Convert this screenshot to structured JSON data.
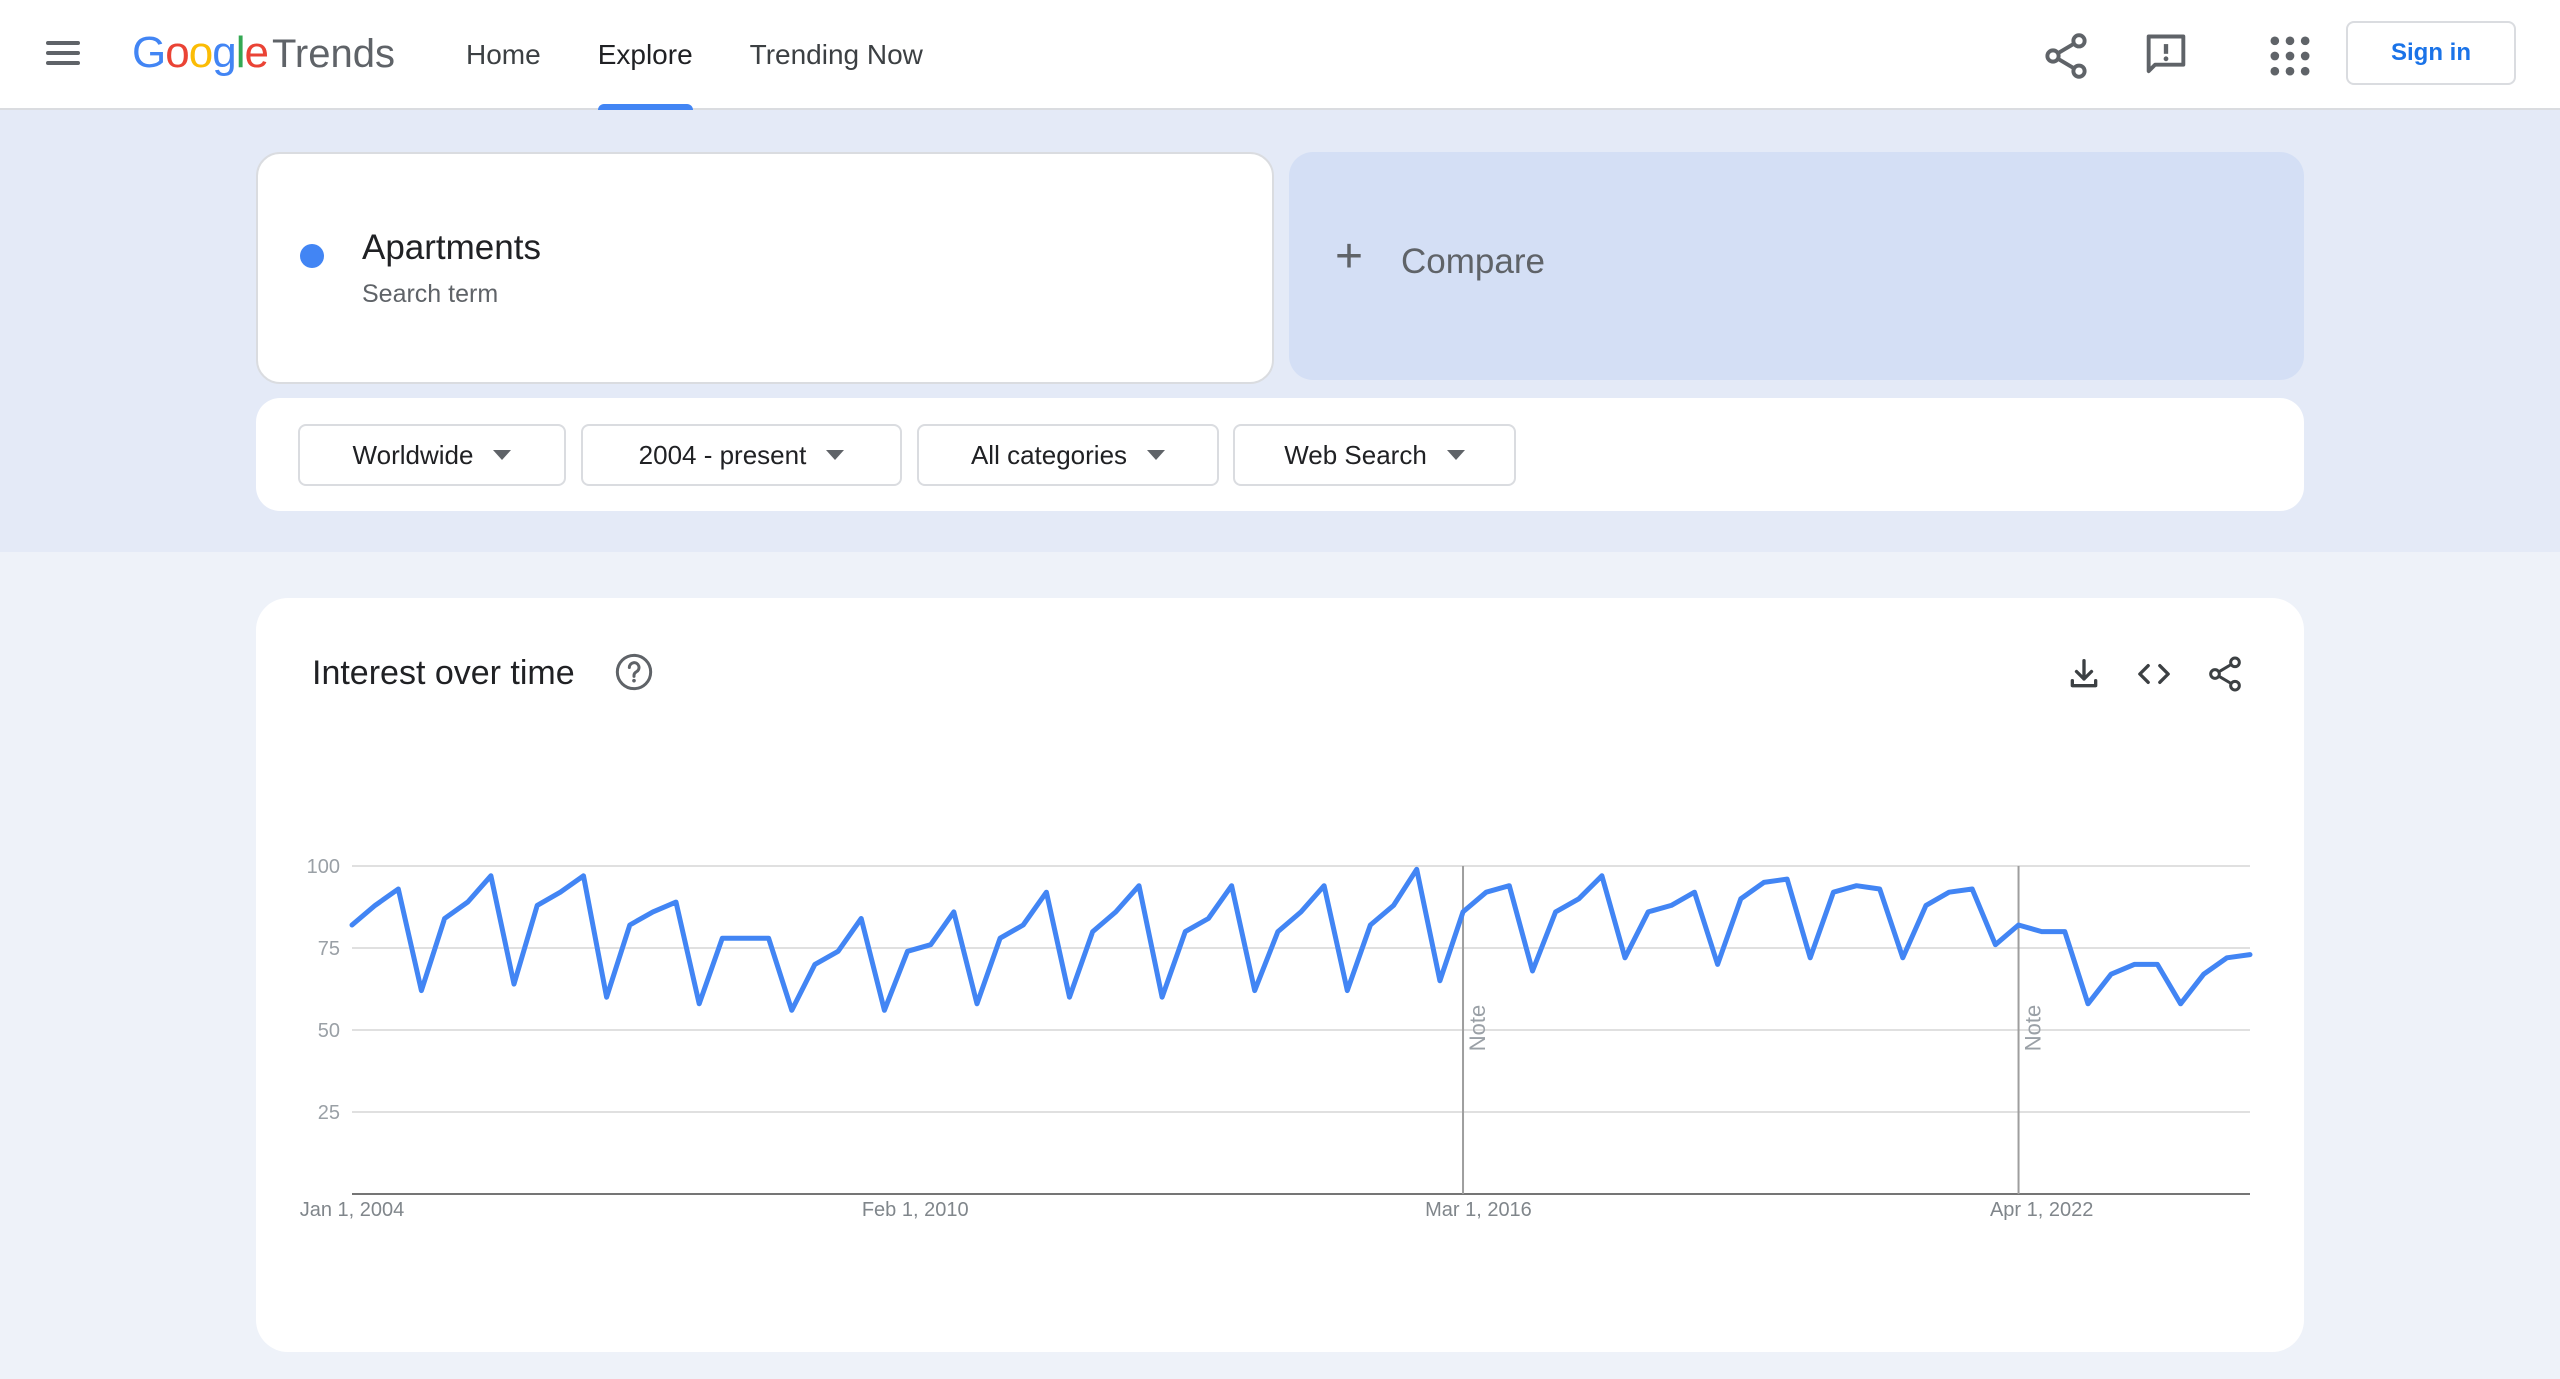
{
  "header": {
    "logo_google": "Google",
    "logo_trends": "Trends",
    "nav": [
      {
        "label": "Home",
        "active": false
      },
      {
        "label": "Explore",
        "active": true
      },
      {
        "label": "Trending Now",
        "active": false
      }
    ],
    "sign_in": "Sign in",
    "icons": [
      "menu-icon",
      "share-icon",
      "feedback-icon",
      "apps-icon"
    ]
  },
  "search": {
    "term": "Apartments",
    "term_type": "Search term",
    "term_color": "#4285f4",
    "compare_label": "Compare"
  },
  "filters": {
    "region": "Worldwide",
    "time": "2004 - present",
    "category": "All categories",
    "property": "Web Search"
  },
  "chart_card": {
    "title": "Interest over time",
    "icons": [
      "help-icon",
      "download-icon",
      "embed-icon",
      "share-icon"
    ]
  },
  "chart_data": {
    "type": "line",
    "title": "Interest over time",
    "ylim": [
      0,
      100
    ],
    "yticks": [
      25,
      50,
      75,
      100
    ],
    "ytick_labels": [
      "25",
      "50",
      "75",
      "100"
    ],
    "xlim": [
      "2004-01",
      "2024-07"
    ],
    "xticks": [
      {
        "date": "2004-01",
        "label": "Jan 1, 2004"
      },
      {
        "date": "2010-02",
        "label": "Feb 1, 2010"
      },
      {
        "date": "2016-03",
        "label": "Mar 1, 2016"
      },
      {
        "date": "2022-04",
        "label": "Apr 1, 2022"
      }
    ],
    "grid": true,
    "annotations": [
      {
        "date": "2016-01",
        "label": "Note"
      },
      {
        "date": "2022-01",
        "label": "Note"
      }
    ],
    "series": [
      {
        "color": "#4285f4",
        "x": [
          "2004-01",
          "2004-04",
          "2004-07",
          "2004-10",
          "2005-01",
          "2005-04",
          "2005-07",
          "2005-10",
          "2006-01",
          "2006-04",
          "2006-07",
          "2006-10",
          "2007-01",
          "2007-04",
          "2007-07",
          "2007-10",
          "2008-01",
          "2008-04",
          "2008-07",
          "2008-10",
          "2009-01",
          "2009-04",
          "2009-07",
          "2009-10",
          "2010-01",
          "2010-04",
          "2010-07",
          "2010-10",
          "2011-01",
          "2011-04",
          "2011-07",
          "2011-10",
          "2012-01",
          "2012-04",
          "2012-07",
          "2012-10",
          "2013-01",
          "2013-04",
          "2013-07",
          "2013-10",
          "2014-01",
          "2014-04",
          "2014-07",
          "2014-10",
          "2015-01",
          "2015-04",
          "2015-07",
          "2015-10",
          "2016-01",
          "2016-04",
          "2016-07",
          "2016-10",
          "2017-01",
          "2017-04",
          "2017-07",
          "2017-10",
          "2018-01",
          "2018-04",
          "2018-07",
          "2018-10",
          "2019-01",
          "2019-04",
          "2019-07",
          "2019-10",
          "2020-01",
          "2020-04",
          "2020-07",
          "2020-10",
          "2021-01",
          "2021-04",
          "2021-07",
          "2021-10",
          "2022-01",
          "2022-04",
          "2022-07",
          "2022-10",
          "2023-01",
          "2023-04",
          "2023-07",
          "2023-10",
          "2024-01",
          "2024-04",
          "2024-07"
        ],
        "values": [
          82,
          88,
          93,
          62,
          84,
          89,
          97,
          64,
          88,
          92,
          97,
          60,
          82,
          86,
          89,
          58,
          78,
          78,
          78,
          56,
          70,
          74,
          84,
          56,
          74,
          76,
          86,
          58,
          78,
          82,
          92,
          60,
          80,
          86,
          94,
          60,
          80,
          84,
          94,
          62,
          80,
          86,
          94,
          62,
          82,
          88,
          99,
          65,
          86,
          92,
          94,
          68,
          86,
          90,
          97,
          72,
          86,
          88,
          92,
          70,
          90,
          95,
          96,
          72,
          92,
          94,
          93,
          72,
          88,
          92,
          93,
          76,
          82,
          80,
          80,
          58,
          67,
          70,
          70,
          58,
          67,
          72,
          73
        ]
      }
    ]
  }
}
